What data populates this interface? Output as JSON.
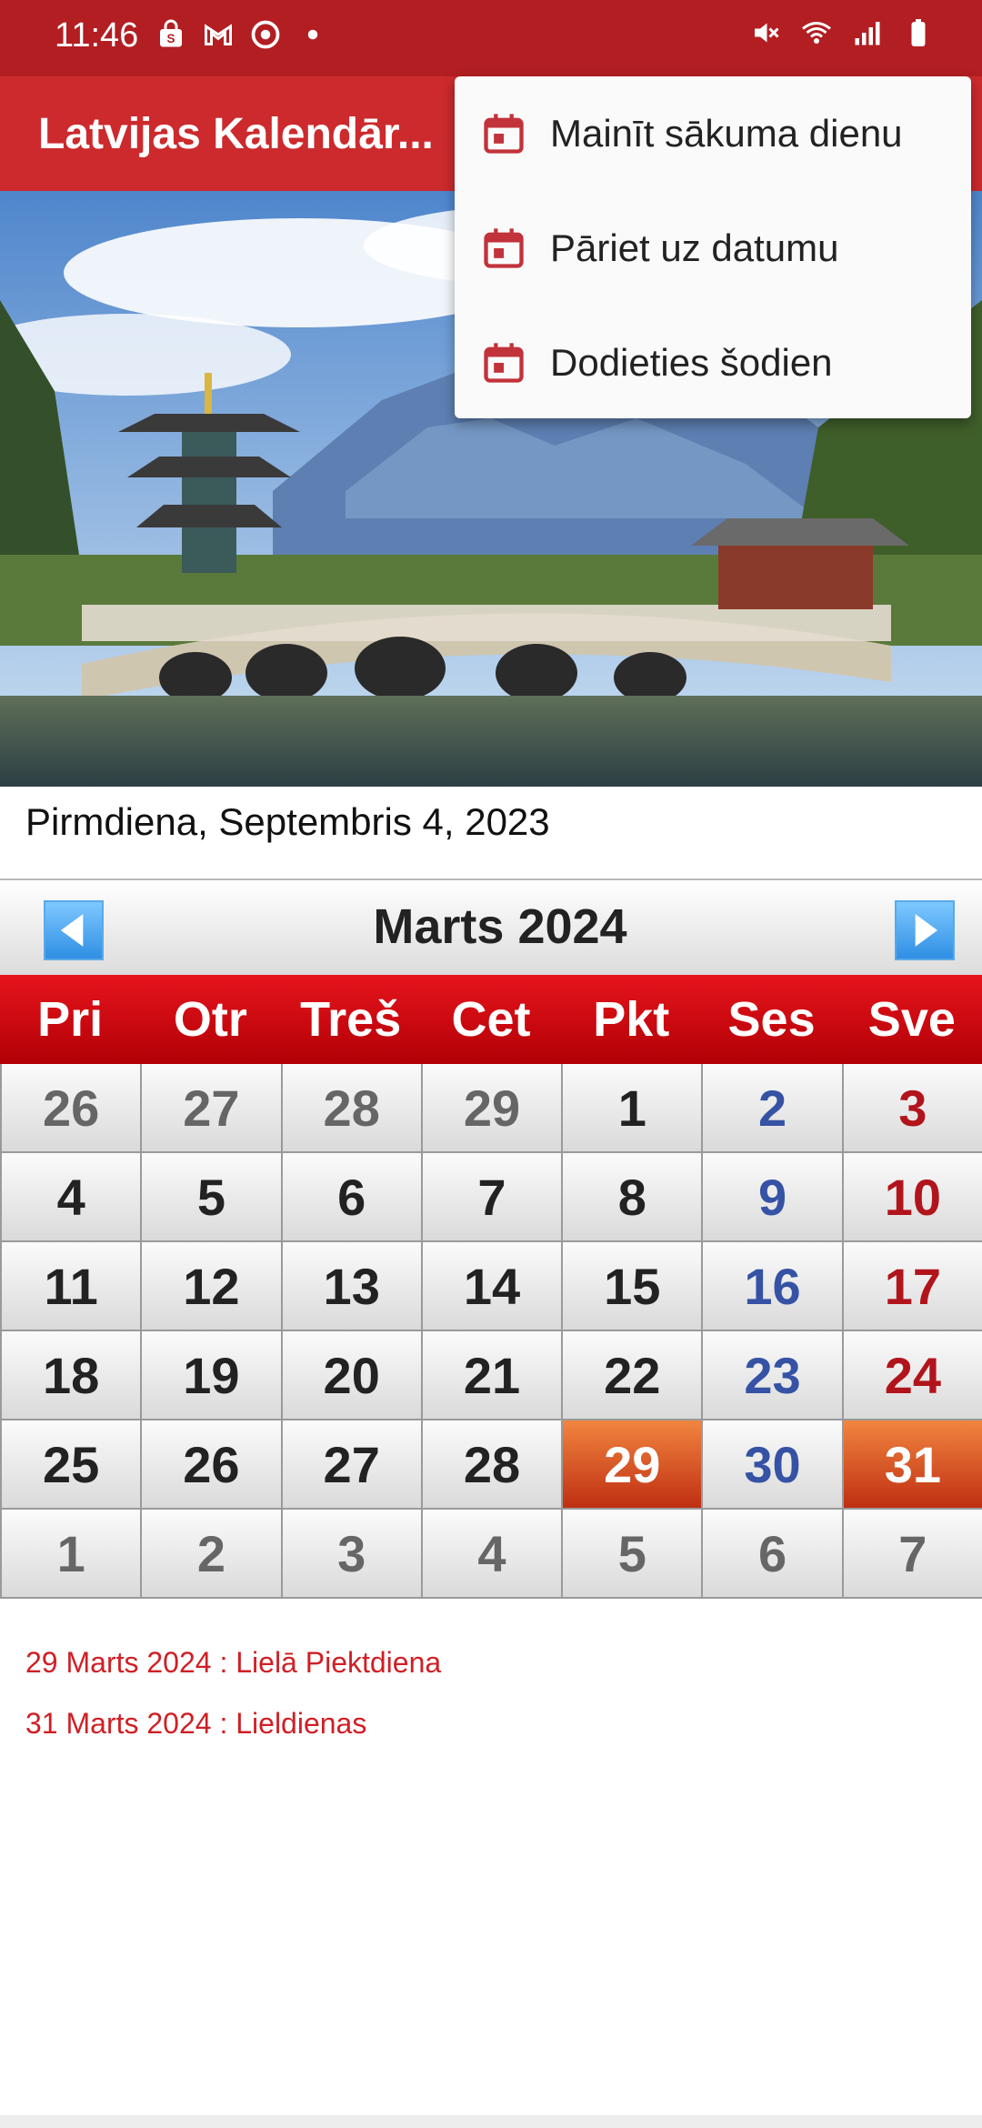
{
  "status_bar": {
    "time": "11:46"
  },
  "app_bar": {
    "title": "Latvijas Kalendār..."
  },
  "current_date": "Pirmdiena, Septembris 4, 2023",
  "calendar": {
    "month_title": "Marts  2024",
    "weekdays": [
      "Pri",
      "Otr",
      "Treš",
      "Cet",
      "Pkt",
      "Ses",
      "Sve"
    ],
    "rows": [
      [
        "26",
        "27",
        "28",
        "29",
        "1",
        "2",
        "3"
      ],
      [
        "4",
        "5",
        "6",
        "7",
        "8",
        "9",
        "10"
      ],
      [
        "11",
        "12",
        "13",
        "14",
        "15",
        "16",
        "17"
      ],
      [
        "18",
        "19",
        "20",
        "21",
        "22",
        "23",
        "24"
      ],
      [
        "25",
        "26",
        "27",
        "28",
        "29",
        "30",
        "31"
      ],
      [
        "1",
        "2",
        "3",
        "4",
        "5",
        "6",
        "7"
      ]
    ]
  },
  "holidays": [
    "29 Marts 2024 : Lielā Piektdiena",
    "31 Marts 2024 : Lieldienas"
  ],
  "menu": {
    "items": [
      {
        "label": "Mainīt sākuma dienu",
        "icon": "calendar-icon"
      },
      {
        "label": "Pāriet uz datumu",
        "icon": "calendar-icon"
      },
      {
        "label": "Dodieties šodien",
        "icon": "calendar-icon"
      }
    ]
  },
  "colors": {
    "status_bar": "#b21e22",
    "app_bar": "#cc2a2d",
    "weekday_header": "#d60a12",
    "holiday_cell": "#e0622e",
    "saturday": "#3552a4",
    "sunday": "#b2141c",
    "holiday_text": "#d01f25"
  }
}
